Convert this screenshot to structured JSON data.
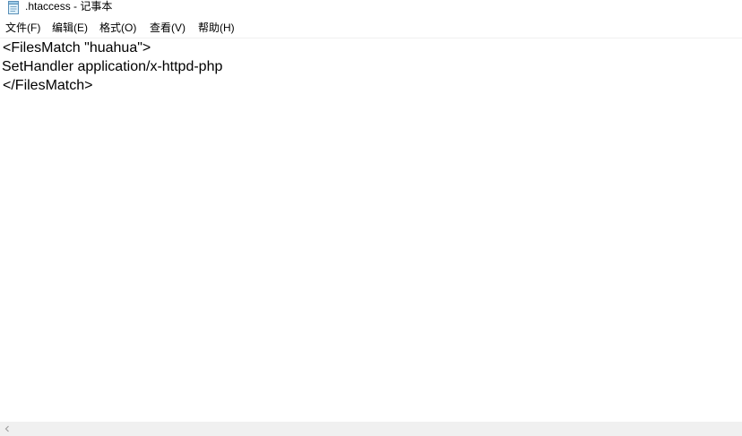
{
  "window": {
    "title": ".htaccess - 记事本",
    "icon": "notepad-icon"
  },
  "menu": {
    "file": "文件(F)",
    "edit": "编辑(E)",
    "format": "格式(O)",
    "view": "查看(V)",
    "help": "帮助(H)"
  },
  "editor": {
    "lines": [
      "<FilesMatch \"huahua\">",
      "SetHandler application/x-httpd-php",
      "</FilesMatch>"
    ]
  },
  "scrollbar": {
    "left_arrow_icon": "chevron-left-icon"
  }
}
